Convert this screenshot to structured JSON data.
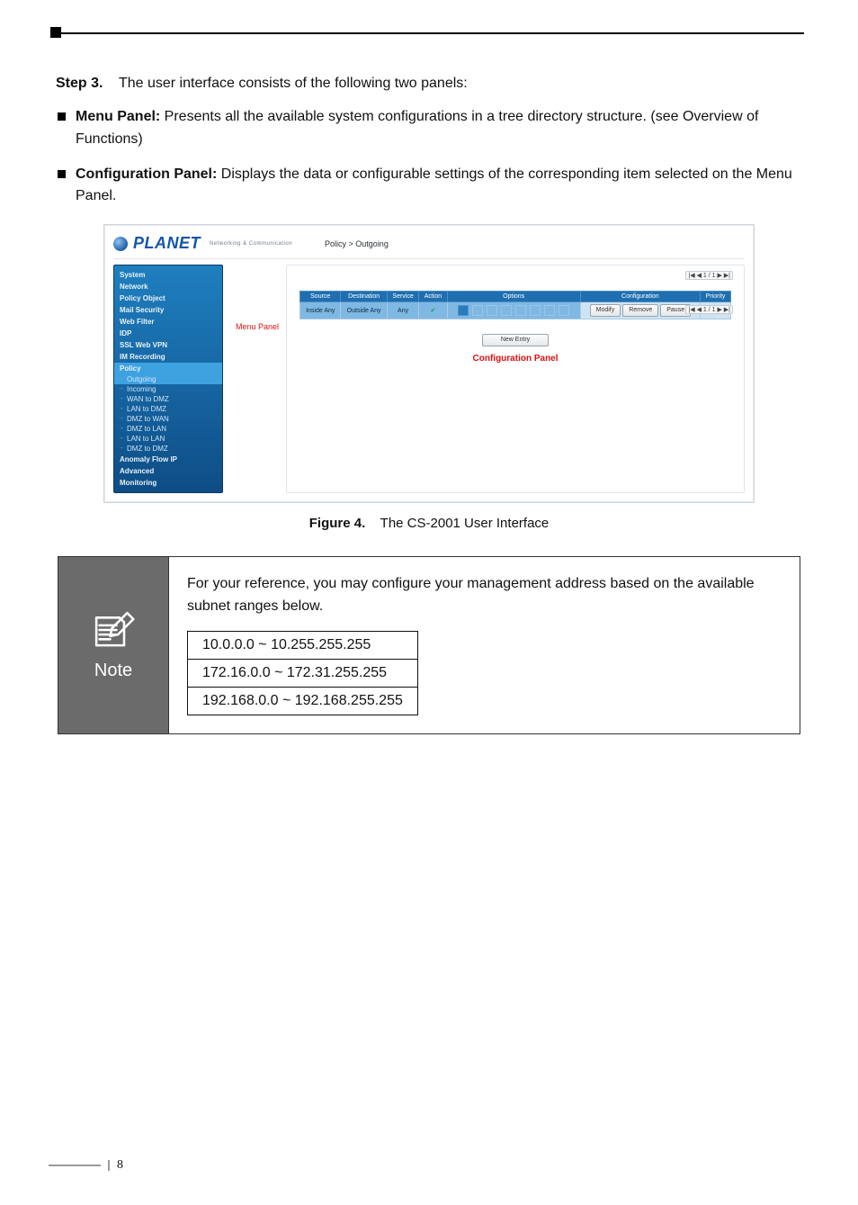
{
  "step": {
    "label": "Step 3.",
    "text": "The user interface consists of the following two panels:"
  },
  "bullet1": {
    "title": "Menu Panel:",
    "text": " Presents all the available system configurations in a tree directory structure. (see Overview of Functions)"
  },
  "bullet2": {
    "title": "Configuration Panel:",
    "text": " Displays the data or configurable settings of the corresponding item selected on the Menu Panel."
  },
  "screenshot": {
    "logo_text": "PLANET",
    "logo_sub": "Networking & Communication",
    "breadcrumb": "Policy > Outgoing",
    "menu_panel_label": "Menu Panel",
    "configuration_panel_label": "Configuration Panel",
    "sidebar": {
      "sections": [
        {
          "label": "System"
        },
        {
          "label": "Network"
        },
        {
          "label": "Policy Object"
        },
        {
          "label": "Mail Security"
        },
        {
          "label": "Web Filter"
        },
        {
          "label": "IDP"
        },
        {
          "label": "SSL Web VPN"
        },
        {
          "label": "IM Recording"
        },
        {
          "label": "Policy",
          "children": [
            "Outgoing",
            "Incoming",
            "WAN to DMZ",
            "LAN to DMZ",
            "DMZ to WAN",
            "DMZ to LAN",
            "LAN to LAN",
            "DMZ to DMZ"
          ]
        },
        {
          "label": "Anomaly Flow IP"
        },
        {
          "label": "Advanced"
        },
        {
          "label": "Monitoring"
        }
      ]
    },
    "table": {
      "headers": [
        "Source",
        "Destination",
        "Service",
        "Action",
        "Options",
        "Configuration",
        "Priority"
      ],
      "row": {
        "source": "Inside Any",
        "destination": "Outside Any",
        "service": "Any",
        "action_icon": "check-icon",
        "config_modify": "Modify",
        "config_remove": "Remove",
        "config_pause": "Pause",
        "priority": "1"
      }
    },
    "pager_text": "|◀ ◀ 1 / 1 ▶ ▶|",
    "new_entry_label": "New Entry"
  },
  "figure": {
    "label": "Figure 4.",
    "caption": "The CS-2001 User Interface"
  },
  "note": {
    "label": "Note",
    "text": "For your reference, you may configure your management address based on the available subnet ranges below.",
    "ranges": [
      "10.0.0.0 ~ 10.255.255.255",
      "172.16.0.0 ~ 172.31.255.255",
      "192.168.0.0 ~ 192.168.255.255"
    ]
  },
  "page_number": "8"
}
